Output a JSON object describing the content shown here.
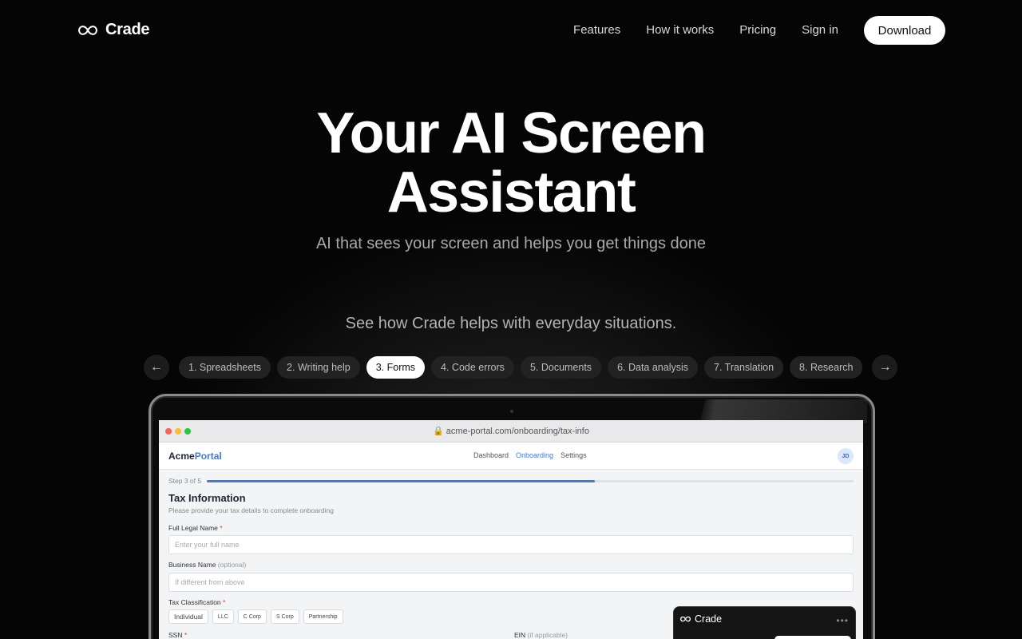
{
  "brand": {
    "name": "Crade"
  },
  "nav": {
    "links": [
      "Features",
      "How it works",
      "Pricing",
      "Sign in"
    ],
    "download_label": "Download"
  },
  "hero": {
    "title_line1": "Your AI Screen",
    "title_line2": "Assistant",
    "subtitle": "AI that sees your screen and helps you get things done"
  },
  "demo": {
    "intro": "See how Crade helps with everyday situations.",
    "prev_arrow": "←",
    "next_arrow": "→",
    "tabs": [
      {
        "label": "1. Spreadsheets",
        "active": false
      },
      {
        "label": "2. Writing help",
        "active": false
      },
      {
        "label": "3. Forms",
        "active": true
      },
      {
        "label": "4. Code errors",
        "active": false
      },
      {
        "label": "5. Documents",
        "active": false
      },
      {
        "label": "6. Data analysis",
        "active": false
      },
      {
        "label": "7. Translation",
        "active": false
      },
      {
        "label": "8. Research",
        "active": false
      }
    ]
  },
  "mock_browser": {
    "lock_icon": "lock-icon",
    "url": "acme-portal.com/onboarding/tax-info",
    "dot_colors": [
      "#ff5f57",
      "#febc2e",
      "#28c840"
    ]
  },
  "mock_app": {
    "logo_part1": "Acme",
    "logo_part2": "Portal",
    "nav": [
      "Dashboard",
      "Onboarding",
      "Settings"
    ],
    "active_nav": "Onboarding",
    "avatar": "JD",
    "step_text": "Step 3 of 5",
    "progress": 0.6,
    "form_title": "Tax Information",
    "form_desc": "Please provide your tax details to complete onboarding",
    "fields": {
      "full_name_label": "Full Legal Name",
      "full_name_placeholder": "Enter your full name",
      "business_label": "Business Name",
      "business_optional": "(optional)",
      "business_placeholder": "If different from above",
      "tax_class_label": "Tax Classification",
      "tax_options": [
        "Individual",
        "LLC",
        "C Corp",
        "S Corp",
        "Partnership"
      ],
      "ssn_label": "SSN",
      "ein_label": "EIN",
      "ein_note": "(if applicable)",
      "required_mark": "*"
    }
  },
  "crade_panel": {
    "name": "Crade",
    "more": "•••"
  },
  "colors": {
    "accent": "#3d7bd9",
    "background": "#050505"
  }
}
